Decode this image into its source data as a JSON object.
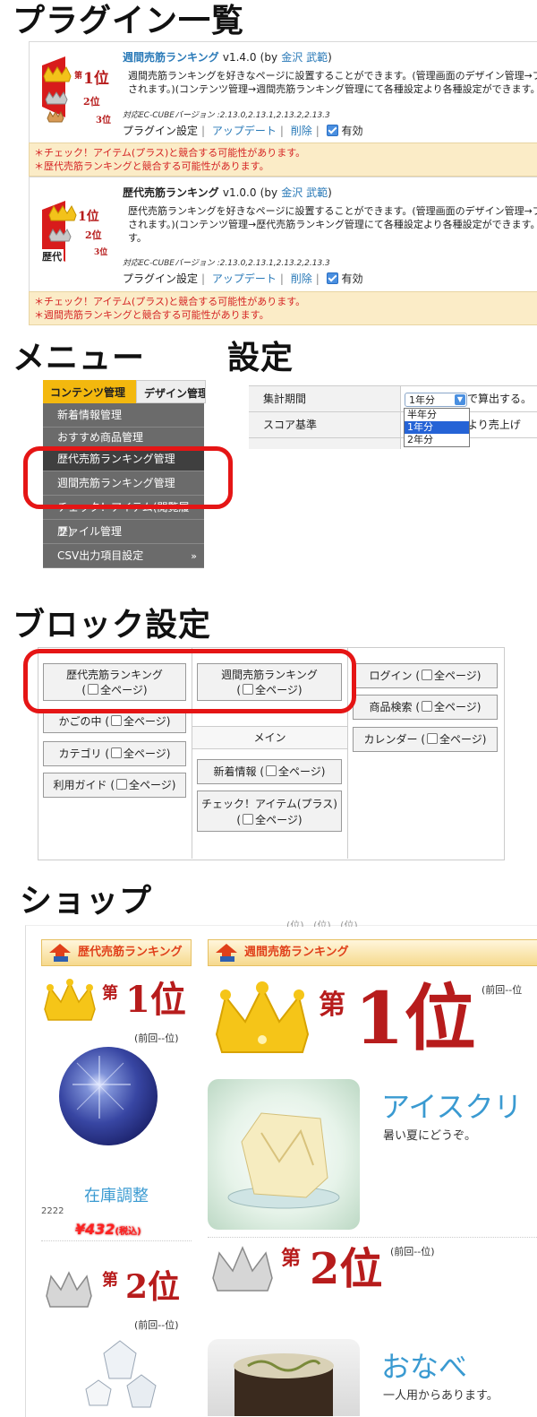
{
  "headings": {
    "plugins": "プラグイン一覧",
    "menu": "メニュー",
    "settings": "設定",
    "blocks": "ブロック設定",
    "shop": "ショップ"
  },
  "plugins": [
    {
      "title": "週間売筋ランキング",
      "version": "v1.4.0",
      "by_prefix": "(by",
      "author": "金沢 武範",
      "by_suffix": ")",
      "desc1": "週間売筋ランキングを好きなページに設置することができます。(管理画面のデザイン管理→ブロック",
      "desc2": "されます。)(コンテンツ管理→週間売筋ランキング管理にて各種設定より各種設定ができます。",
      "desc3": "",
      "compat": "対応EC-CUBEバージョン :2.13.0,2.13.1,2.13.2,2.13.3",
      "settings_label": "プラグイン設定",
      "update_label": "アップデート",
      "delete_label": "削除",
      "enabled_label": "有効",
      "warnings": [
        "＊チェック！アイテム(プラス)と競合する可能性があります。",
        "＊歴代売筋ランキングと競合する可能性があります。"
      ]
    },
    {
      "title": "歴代売筋ランキング",
      "version": "v1.0.0",
      "by_prefix": "(by",
      "author": "金沢 武範",
      "by_suffix": ")",
      "desc1": "歴代売筋ランキングを好きなページに設置することができます。(管理画面のデザイン管理→ブロック",
      "desc2": "されます。)(コンテンツ管理→歴代売筋ランキング管理にて各種設定より各種設定ができます。",
      "desc3": "す。",
      "compat": "対応EC-CUBEバージョン :2.13.0,2.13.1,2.13.2,2.13.3",
      "settings_label": "プラグイン設定",
      "update_label": "アップデート",
      "delete_label": "削除",
      "enabled_label": "有効",
      "warnings": [
        "＊チェック！アイテム(プラス)と競合する可能性があります。",
        "＊週間売筋ランキングと競合する可能性があります。"
      ]
    }
  ],
  "thumb_text": {
    "first": "1位",
    "second": "2位",
    "third": "3位",
    "dai": "第",
    "rekidai": "歴代"
  },
  "menu": {
    "tab_active": "コンテンツ管理",
    "tab_other": "デザイン管理",
    "items": [
      "新着情報管理",
      "おすすめ商品管理",
      "歴代売筋ランキング管理",
      "週間売筋ランキング管理",
      "チェック！アイテム(閲覧履歴)",
      "ファイル管理",
      "CSV出力項目設定"
    ],
    "more": "»"
  },
  "settings": {
    "rows": [
      {
        "label": "集計期間",
        "value": "1年分",
        "suffix": "で算出する。"
      },
      {
        "label": "スコア基準",
        "value": "",
        "suffix": "より売上げ"
      },
      {
        "label": "",
        "value": "",
        "suffix": ""
      }
    ],
    "options": [
      "半年分",
      "1年分",
      "2年分"
    ],
    "selected": "1年分"
  },
  "blocks": {
    "left": [
      {
        "name": "歴代売筋ランキング",
        "all": "全ページ"
      },
      {
        "name": "かごの中",
        "all": "全ページ"
      },
      {
        "name": "カテゴリ",
        "all": "全ページ"
      },
      {
        "name": "利用ガイド",
        "all": "全ページ"
      }
    ],
    "center_top": [
      {
        "name": "週間売筋ランキング",
        "all": "全ページ"
      }
    ],
    "center_label": "メイン",
    "center_bottom": [
      {
        "name": "新着情報",
        "all": "全ページ"
      },
      {
        "name": "チェック！アイテム(プラス)",
        "all": "全ページ"
      }
    ],
    "right": [
      {
        "name": "ログイン",
        "all": "全ページ"
      },
      {
        "name": "商品検索",
        "all": "全ページ"
      },
      {
        "name": "カレンダー",
        "all": "全ページ"
      }
    ]
  },
  "shop": {
    "left_title": "歴代売筋ランキング",
    "right_title": "週間売筋ランキング",
    "top_clip": "(位)   (位)   (位)",
    "dai": "第",
    "rank1": "1位",
    "rank2": "2位",
    "prev": "(前回--位)",
    "prev_cut": "(前回--位",
    "left_item1": {
      "name": "在庫調整",
      "code": "2222",
      "price": "¥432",
      "tax": "(税込)"
    },
    "right_item1": {
      "name": "アイスクリ",
      "desc": "暑い夏にどうぞ。"
    },
    "right_item2": {
      "name": "おなべ",
      "desc": "一人用からあります。"
    }
  },
  "colors": {
    "accent": "#f3b80e",
    "link": "#2a7ab8",
    "warn_bg": "#fbecc7",
    "warn_text": "#d52525",
    "highlight": "#e51515",
    "rank_red": "#b71c1c"
  }
}
